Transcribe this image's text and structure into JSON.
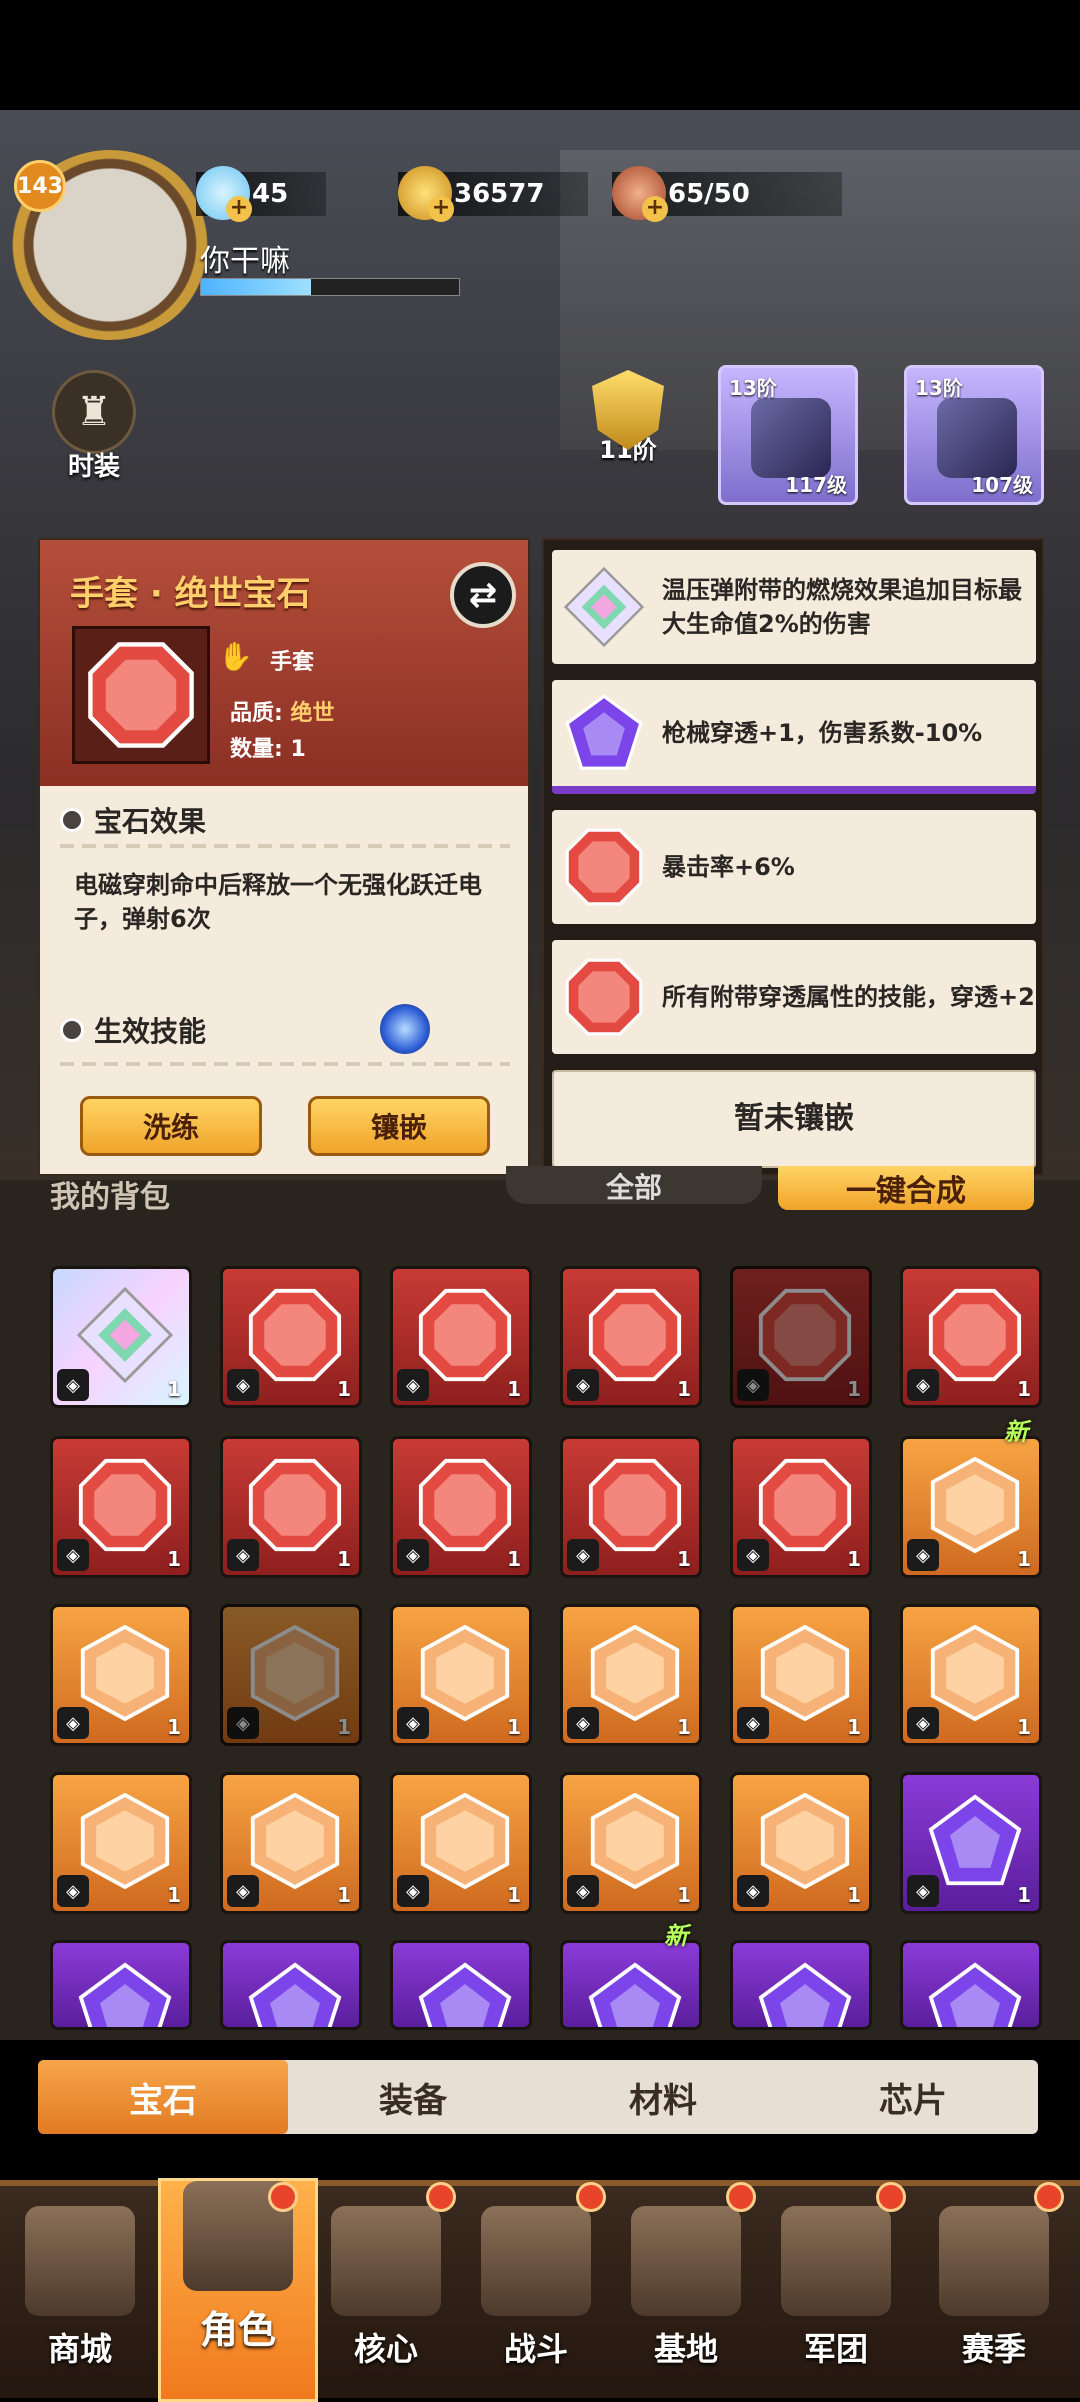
{
  "player": {
    "level": "143",
    "name": "你干嘛"
  },
  "resources": {
    "diamonds": "45",
    "coins": "36577",
    "stamina": "65/50"
  },
  "left_menu": {
    "fashion_label": "时装"
  },
  "character": {
    "rank_label": "11阶",
    "equip_slots": [
      {
        "tier": "13阶",
        "level": "117级"
      },
      {
        "tier": "13阶",
        "level": "107级"
      }
    ]
  },
  "gem_detail": {
    "title": "手套 · 绝世宝石",
    "slot_label": "手套",
    "quality_label": "品质:",
    "quality_value": "绝世",
    "count_label": "数量:",
    "count_value": "1",
    "effect_heading": "宝石效果",
    "effect_text": "电磁穿刺命中后释放一个无强化跃迁电子，弹射6次",
    "skill_heading": "生效技能",
    "refine_button": "洗练",
    "inlay_button": "镶嵌"
  },
  "effects": [
    {
      "gem": "rainbow",
      "text": "温压弹附带的燃烧效果追加目标最大生命值2%的伤害"
    },
    {
      "gem": "purple",
      "text": "枪械穿透+1，伤害系数-10%"
    },
    {
      "gem": "red",
      "text": "暴击率+6%"
    },
    {
      "gem": "red",
      "text": "所有附带穿透属性的技能，穿透+2"
    },
    {
      "gem": "none",
      "text": "暂未镶嵌"
    }
  ],
  "bag": {
    "header_left": "我的背包",
    "filter_label": "全部",
    "merge_label": "一键合成",
    "new_tag": "新",
    "rows": [
      [
        {
          "color": "rainbow",
          "count": "1"
        },
        {
          "color": "red",
          "count": "1"
        },
        {
          "color": "red",
          "count": "1"
        },
        {
          "color": "red",
          "count": "1"
        },
        {
          "color": "red",
          "count": "1",
          "dim": true
        },
        {
          "color": "red",
          "count": "1"
        }
      ],
      [
        {
          "color": "red",
          "count": "1"
        },
        {
          "color": "red",
          "count": "1"
        },
        {
          "color": "red",
          "count": "1"
        },
        {
          "color": "red",
          "count": "1"
        },
        {
          "color": "red",
          "count": "1"
        },
        {
          "color": "orange",
          "count": "1",
          "new": true
        }
      ],
      [
        {
          "color": "orange",
          "count": "1"
        },
        {
          "color": "orange",
          "count": "1",
          "dim": true
        },
        {
          "color": "orange",
          "count": "1"
        },
        {
          "color": "orange",
          "count": "1"
        },
        {
          "color": "orange",
          "count": "1"
        },
        {
          "color": "orange",
          "count": "1"
        }
      ],
      [
        {
          "color": "orange",
          "count": "1"
        },
        {
          "color": "orange",
          "count": "1"
        },
        {
          "color": "orange",
          "count": "1"
        },
        {
          "color": "orange",
          "count": "1"
        },
        {
          "color": "orange",
          "count": "1"
        },
        {
          "color": "purple",
          "count": "1"
        }
      ],
      [
        {
          "color": "purple",
          "count": ""
        },
        {
          "color": "purple",
          "count": ""
        },
        {
          "color": "purple",
          "count": ""
        },
        {
          "color": "purple",
          "count": "",
          "new": true
        },
        {
          "color": "purple",
          "count": ""
        },
        {
          "color": "purple",
          "count": ""
        }
      ]
    ]
  },
  "category_tabs": [
    "宝石",
    "装备",
    "材料",
    "芯片"
  ],
  "active_category": 0,
  "bottom_nav": [
    "商城",
    "角色",
    "核心",
    "战斗",
    "基地",
    "军团",
    "赛季"
  ],
  "active_nav": 1,
  "colors": {
    "red_gem": "#e24a42",
    "orange_gem": "#f7b377",
    "purple_gem": "#7b45ea",
    "accent_orange": "#f07a1e"
  }
}
